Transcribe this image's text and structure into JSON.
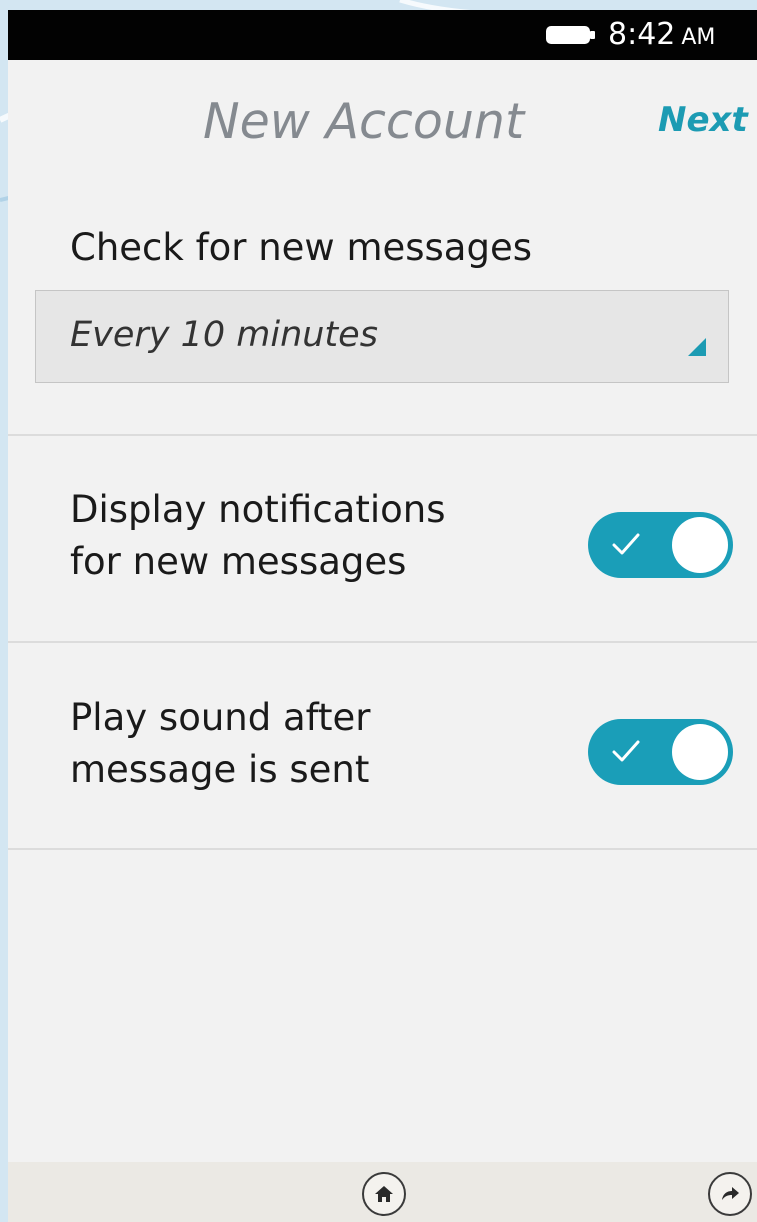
{
  "status_bar": {
    "time": "8:42",
    "ampm": "AM"
  },
  "header": {
    "title": "New Account",
    "next_label": "Next"
  },
  "check_messages": {
    "label": "Check for new messages",
    "selected": "Every 10 minutes"
  },
  "settings": [
    {
      "line1": "Display notifications",
      "line2": "for new messages",
      "enabled": true
    },
    {
      "line1": "Play sound after",
      "line2": "message is sent",
      "enabled": true
    }
  ],
  "colors": {
    "accent": "#1a9eb8",
    "title_gray": "#858a90",
    "background": "#f2f2f2"
  },
  "icons": {
    "battery": "battery-icon",
    "dropdown": "dropdown-arrow-icon",
    "toggle_check": "checkmark-icon",
    "home": "home-icon",
    "forward": "forward-arrow-icon"
  }
}
